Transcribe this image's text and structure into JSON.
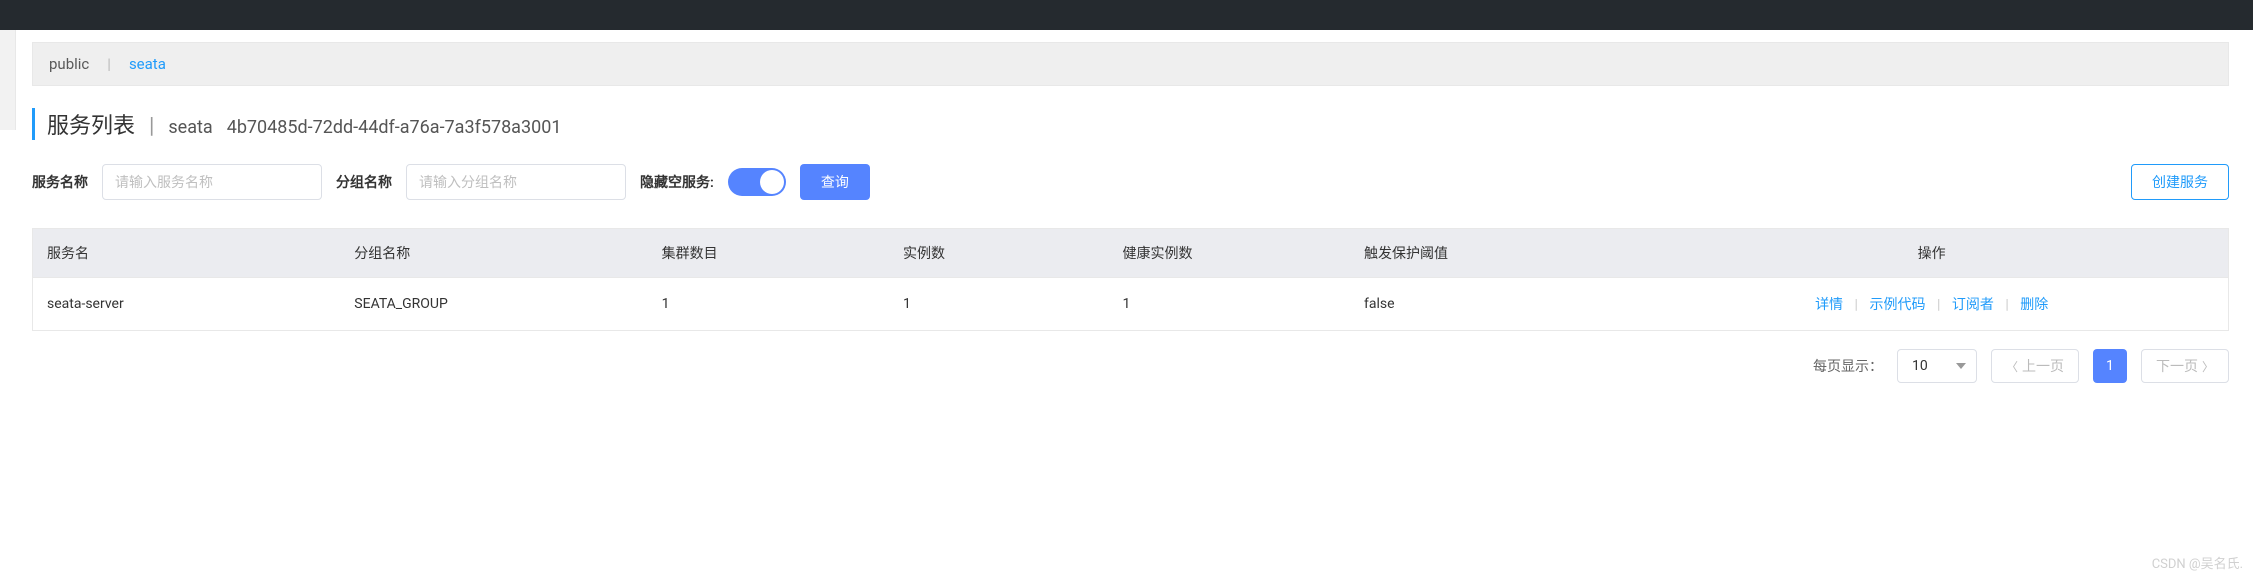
{
  "namespace_tabs": {
    "items": [
      "public",
      "seata"
    ],
    "active_index": 1
  },
  "header": {
    "title": "服务列表",
    "ns_name": "seata",
    "ns_id": "4b70485d-72dd-44df-a76a-7a3f578a3001"
  },
  "search": {
    "service_name_label": "服务名称",
    "service_name_placeholder": "请输入服务名称",
    "service_name_value": "",
    "group_name_label": "分组名称",
    "group_name_placeholder": "请输入分组名称",
    "group_name_value": "",
    "hide_empty_label": "隐藏空服务:",
    "hide_empty_on": true,
    "query_btn": "查询",
    "create_btn": "创建服务"
  },
  "table": {
    "columns": [
      "服务名",
      "分组名称",
      "集群数目",
      "实例数",
      "健康实例数",
      "触发保护阈值",
      "操作"
    ],
    "rows": [
      {
        "service_name": "seata-server",
        "group_name": "SEATA_GROUP",
        "cluster_count": "1",
        "instance_count": "1",
        "healthy_count": "1",
        "threshold": "false"
      }
    ],
    "ops": {
      "detail": "详情",
      "sample": "示例代码",
      "subscribers": "订阅者",
      "delete": "删除"
    }
  },
  "pagination": {
    "page_size_label": "每页显示：",
    "page_size": "10",
    "prev": "上一页",
    "next": "下一页",
    "current": "1"
  },
  "watermark": "CSDN @吴名氏."
}
